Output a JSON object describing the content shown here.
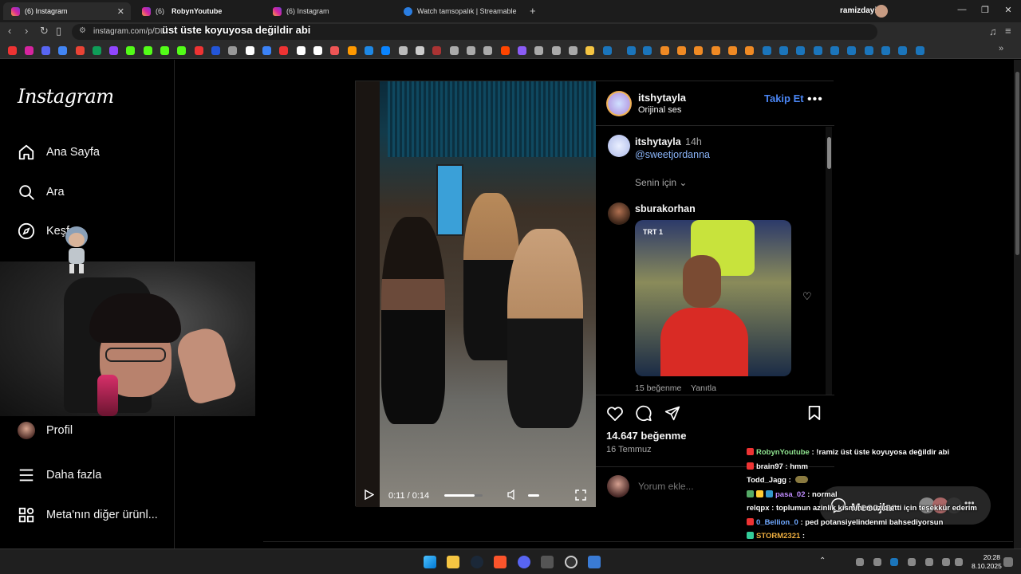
{
  "browser": {
    "tabs": [
      {
        "label": "(6) Instagram",
        "active": true
      },
      {
        "label": "(6)",
        "active": false
      },
      {
        "label": "(6) Instagram",
        "active": false
      },
      {
        "label": "Watch tamsopalık | Streamable",
        "active": false
      }
    ],
    "user": "ramizdayi",
    "url": "instagram.com/p/DL",
    "overlay_title": "üst üste koyuyosa değildir abi",
    "overlay_user": "RobynYoutube"
  },
  "sidebar": {
    "logo": "Instagram",
    "items": [
      {
        "label": "Ana Sayfa",
        "icon": "home-icon"
      },
      {
        "label": "Ara",
        "icon": "search-icon"
      },
      {
        "label": "Keşfet",
        "icon": "compass-icon"
      },
      {
        "label": "Profil",
        "icon": "profile-avatar"
      },
      {
        "label": "Daha fazla",
        "icon": "menu-icon"
      },
      {
        "label": "Meta'nın diğer ürünl...",
        "icon": "grid-icon"
      }
    ]
  },
  "video": {
    "time": "0:11 / 0:14",
    "progress": 0.79
  },
  "post": {
    "username": "itshytayla",
    "audio": "Orijinal ses",
    "follow_label": "Takip Et",
    "caption": {
      "username": "itshytayla",
      "time": "14h",
      "mention": "@sweetjordanna"
    },
    "for_you": "Senin için",
    "comments": [
      {
        "username": "sburakorhan",
        "gif_logo": "TRT 1",
        "likes": "15 beğenme",
        "reply": "Yanıtla"
      }
    ],
    "likes": "14.647 beğenme",
    "date": "16 Temmuz",
    "comment_placeholder": "Yorum ekle..."
  },
  "messages": {
    "label": "Mesajlar"
  },
  "chat": [
    {
      "user": "RobynYoutube",
      "text": "!ramiz üst üste koyuyosa değildir abi",
      "color": "#8fe38f"
    },
    {
      "user": "brain97",
      "text": "hmm",
      "color": "#ffffff"
    },
    {
      "user": "Todd_Jagg",
      "text": "",
      "color": "#ffffff"
    },
    {
      "user": "pasa_02",
      "text": "normal",
      "color": "#c08cff"
    },
    {
      "user": "relqpx",
      "text": "toplumun azinlik kismini müzid etti için teşekkür ederim",
      "color": "#ffffff"
    },
    {
      "user": "0_Bellion_0",
      "text": "ped potansiyelindenmi bahsediyorsun",
      "color": "#6fa8ff"
    },
    {
      "user": "STORM2321",
      "text": "",
      "color": "#f0b040"
    }
  ],
  "taskbar": {
    "time": "20:28",
    "date": "8.10.2025"
  }
}
